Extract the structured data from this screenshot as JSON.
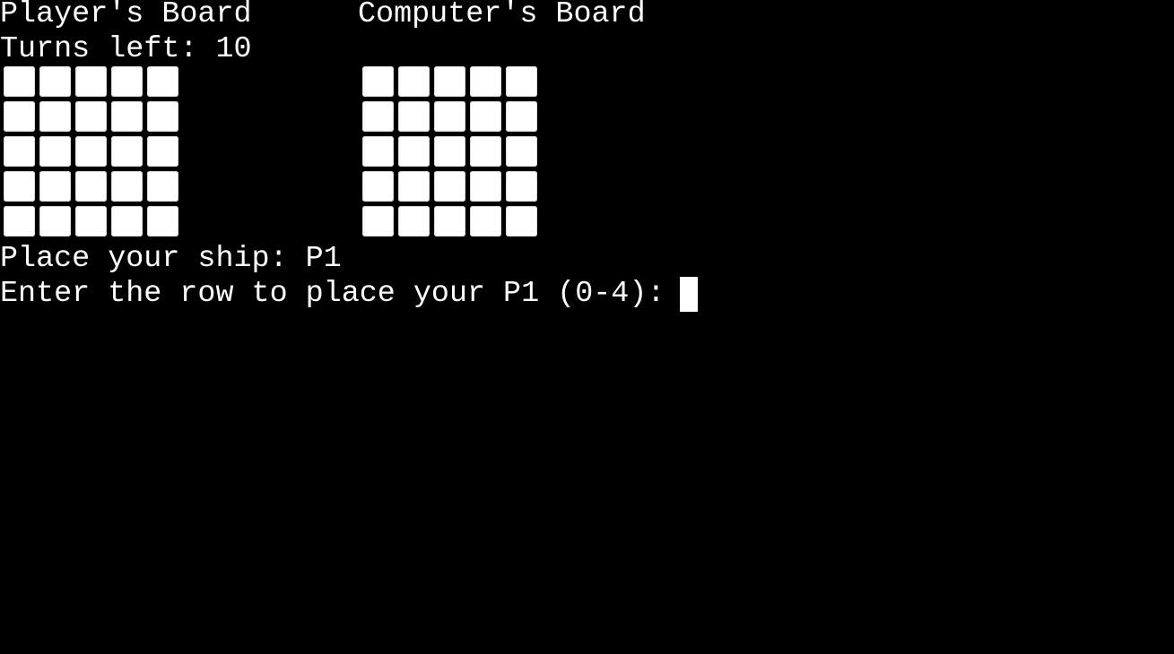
{
  "terminal": {
    "background": "#000000",
    "foreground": "#ffffff",
    "player_board_title": "Player's Board",
    "computer_board_title": "Computer's Board",
    "turns_left_text": "Turns left: 10",
    "place_ship_text": "Place your ship: P1",
    "row_prompt_text": "Enter the row to place your P1 (0-4): ",
    "input_value": ""
  },
  "boards": {
    "rows": 5,
    "cols": 5,
    "cell_glyph": "white-square"
  }
}
